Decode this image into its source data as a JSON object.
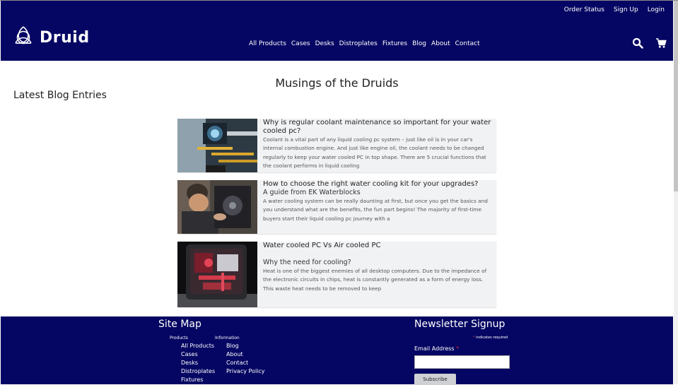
{
  "header": {
    "top_links": [
      "Order Status",
      "Sign Up",
      "Login"
    ],
    "brand": "Druid",
    "nav": [
      "All Products",
      "Cases",
      "Desks",
      "Distroplates",
      "Fixtures",
      "Blog",
      "About",
      "Contact"
    ],
    "icons": [
      "search-icon",
      "cart-icon"
    ]
  },
  "main": {
    "page_title": "Musings of the Druids",
    "section_title": "Latest Blog Entries",
    "posts": [
      {
        "title": "Why is regular coolant maintenance so important for your water cooled pc?",
        "subtitle": "",
        "excerpt": "Coolant is a vital part of any liquid cooling pc system – just like oil is in your car's internal combustion engine. And just like engine oil, the coolant needs to be changed regularly to keep your water cooled PC in top shape. There are 5  crucial functions that the coolant performs in liquid cooling"
      },
      {
        "title": "How to choose the right water cooling kit for your upgrades?",
        "subtitle": "A guide from EK Waterblocks",
        "excerpt": "A water cooling system can be really daunting at first, but once you get the basics and you understand what are the benefits, the fun part begins! The majority of first-time buyers start their liquid cooling pc journey with a"
      },
      {
        "title": "Water cooled PC Vs Air cooled PC",
        "subtitle": "Why the need for cooling?",
        "excerpt": "Heat is one of the biggest enemies of all desktop computers. Due to the impedance of the electronic circuits in chips, heat is constantly generated as a form of energy loss. This waste heat needs to be removed to keep"
      }
    ]
  },
  "footer": {
    "site_map_title": "Site Map",
    "products_heading": "Products",
    "information_heading": "Information",
    "products_links": [
      "All Products",
      "Cases",
      "Desks",
      "Distroplates",
      "Fixtures"
    ],
    "information_links": [
      "Blog",
      "About",
      "Contact",
      "Privacy Policy"
    ],
    "newsletter_title": "Newsletter Signup",
    "required_note": "indicates required",
    "email_label": "Email Address",
    "subscribe_label": "Subscribe"
  },
  "colors": {
    "header_bg": "#050663",
    "footer_bg": "#050663",
    "card_bg": "#f1f2f4"
  }
}
